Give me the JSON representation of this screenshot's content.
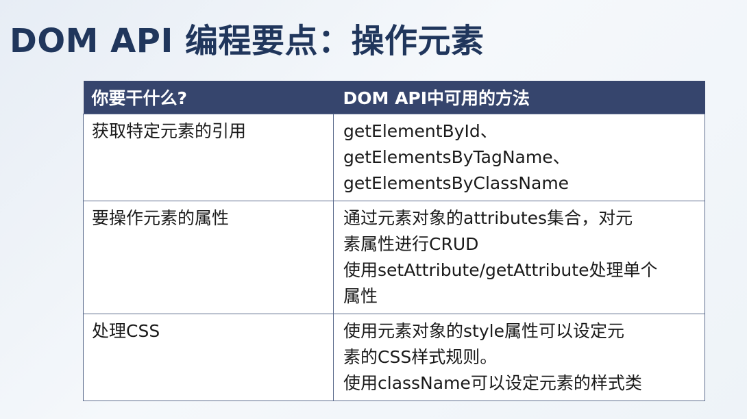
{
  "title": "DOM API 编程要点：操作元素",
  "table": {
    "headers": [
      "你要干什么?",
      "DOM API中可用的方法"
    ],
    "rows": [
      {
        "task": "获取特定元素的引用",
        "method_lines": [
          "getElementById、",
          "getElementsByTagName、",
          "getElementsByClassName"
        ]
      },
      {
        "task": "要操作元素的属性",
        "method_lines": [
          "通过元素对象的attributes集合，对元",
          "素属性进行CRUD",
          "使用setAttribute/getAttribute处理单个",
          "属性"
        ]
      },
      {
        "task": "处理CSS",
        "method_lines": [
          "使用元素对象的style属性可以设定元",
          "素的CSS样式规则。",
          "使用className可以设定元素的样式类"
        ]
      }
    ]
  }
}
